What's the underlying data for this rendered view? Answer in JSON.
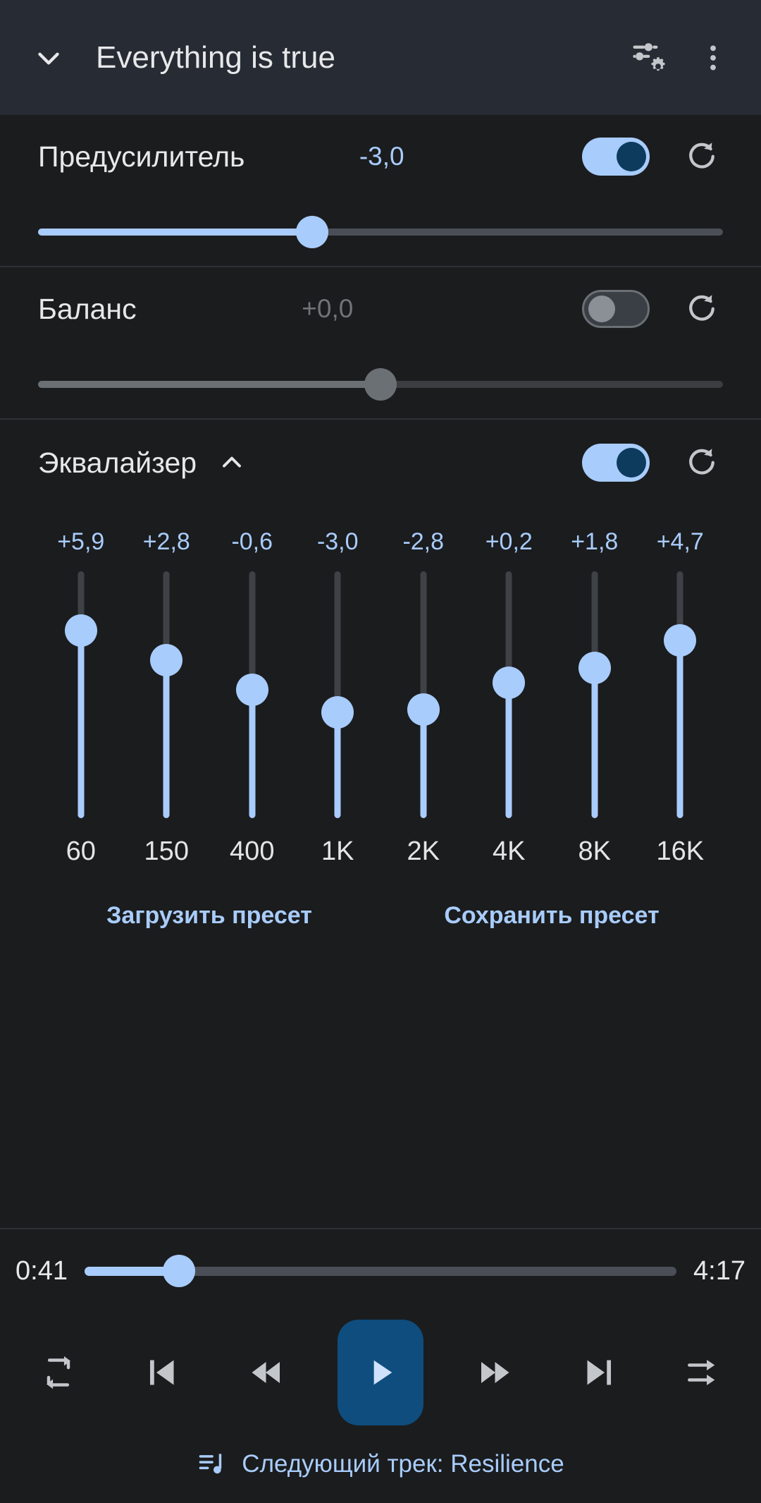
{
  "header": {
    "title": "Everything is true",
    "collapse_icon": "chevron-down-icon",
    "audio_settings_icon": "audio-settings-icon",
    "overflow_icon": "overflow-menu-icon"
  },
  "preamp": {
    "label": "Предусилитель",
    "value": "-3,0",
    "enabled": true,
    "slider_percent": 40,
    "reset_icon": "reset-icon"
  },
  "balance": {
    "label": "Баланс",
    "value": "+0,0",
    "enabled": false,
    "slider_percent": 50,
    "reset_icon": "reset-icon"
  },
  "equalizer": {
    "label": "Эквалайзер",
    "collapse_icon": "chevron-up-icon",
    "enabled": true,
    "reset_icon": "reset-icon",
    "bands": [
      {
        "freq": "60",
        "value": "+5,9",
        "percent": 76
      },
      {
        "freq": "150",
        "value": "+2,8",
        "percent": 64
      },
      {
        "freq": "400",
        "value": "-0,6",
        "percent": 52
      },
      {
        "freq": "1K",
        "value": "-3,0",
        "percent": 43
      },
      {
        "freq": "2K",
        "value": "-2,8",
        "percent": 44
      },
      {
        "freq": "4K",
        "value": "+0,2",
        "percent": 55
      },
      {
        "freq": "8K",
        "value": "+1,8",
        "percent": 61
      },
      {
        "freq": "16K",
        "value": "+4,7",
        "percent": 72
      }
    ],
    "load_preset_label": "Загрузить пресет",
    "save_preset_label": "Сохранить пресет"
  },
  "player": {
    "current_time": "0:41",
    "total_time": "4:17",
    "progress_percent": 16,
    "repeat_icon": "repeat-icon",
    "previous_icon": "skip-previous-icon",
    "rewind_icon": "rewind-icon",
    "play_icon": "play-icon",
    "forward_icon": "fast-forward-icon",
    "next_icon": "skip-next-icon",
    "shuffle_icon": "shuffle-icon",
    "next_track_icon": "queue-music-icon",
    "next_track_label": "Следующий трек: Resilience"
  },
  "colors": {
    "accent": "#a8ccfb",
    "header_bg": "#272b33",
    "body_bg": "#1b1c1e",
    "play_bg": "#0e4d7d"
  }
}
